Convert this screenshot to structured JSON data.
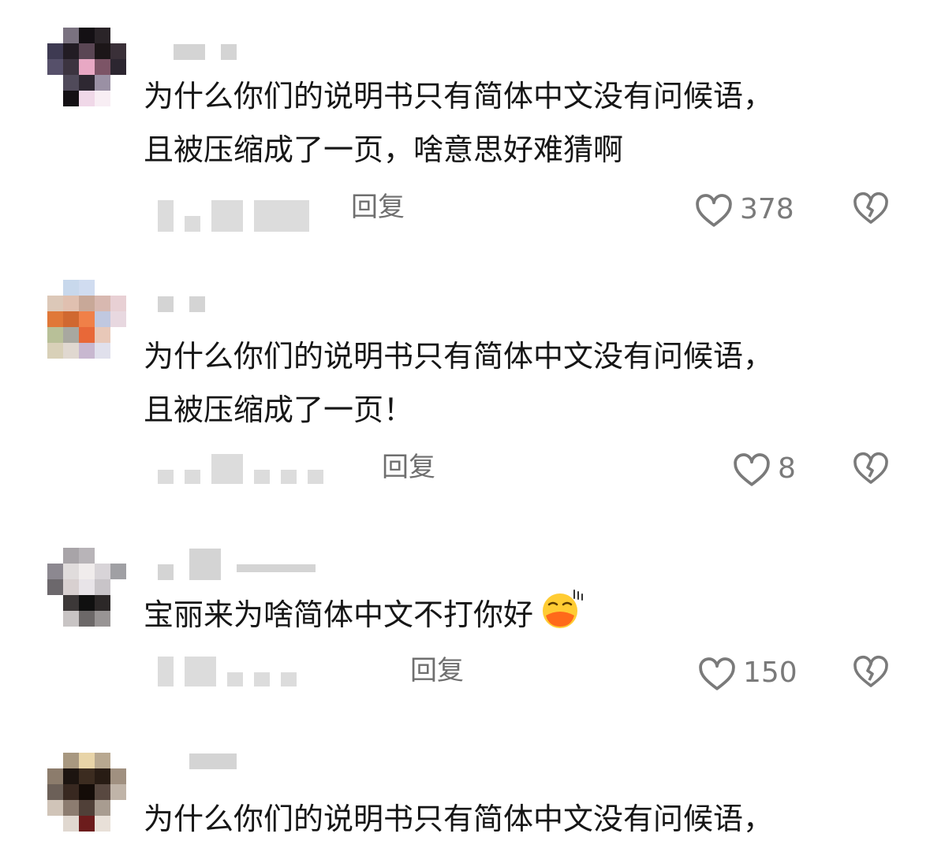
{
  "comments": [
    {
      "text": "为什么你们的说明书只有简体中文没有问候语，\n且被压缩成了一页，啥意思好难猜啊",
      "reply_label": "回复",
      "likes": "378"
    },
    {
      "text": "为什么你们的说明书只有简体中文没有问候语，\n且被压缩成了一页！",
      "reply_label": "回复",
      "likes": "8"
    },
    {
      "text": "宝丽来为啥简体中文不打你好",
      "emoji": "duck-face-emoji",
      "reply_label": "回复",
      "likes": "150"
    },
    {
      "text": "为什么你们的说明书只有简体中文没有问候语，"
    }
  ],
  "colors": {
    "text": "#161616",
    "secondary": "#6f6f6f",
    "icon": "#7a7a7a",
    "blur": "#d4d4d4"
  },
  "icons": {
    "like": "heart-outline-icon",
    "dislike": "broken-heart-icon"
  }
}
